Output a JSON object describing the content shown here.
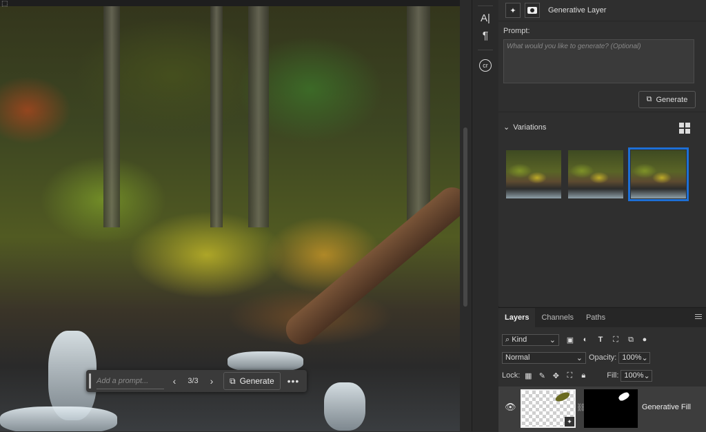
{
  "canvas": {
    "contextual_taskbar": {
      "prompt_placeholder": "Add a prompt...",
      "variation_counter": "3/3",
      "generate_label": "Generate",
      "more_label": "•••"
    }
  },
  "tool_strip": {
    "tools": [
      {
        "icon": "character-panel-icon",
        "glyph": "A|"
      },
      {
        "icon": "paragraph-panel-icon",
        "glyph": "¶"
      },
      {
        "icon": "content-credentials-icon",
        "glyph": "cr"
      }
    ]
  },
  "properties_panel": {
    "header_title": "Generative Layer",
    "prompt_label": "Prompt:",
    "prompt_placeholder": "What would you like to generate? (Optional)",
    "generate_label": "Generate",
    "variations_label": "Variations",
    "variations": [
      {
        "selected": false
      },
      {
        "selected": false
      },
      {
        "selected": true
      }
    ],
    "selection_color": "#1d6fd6"
  },
  "layers_panel": {
    "tabs": [
      "Layers",
      "Channels",
      "Paths"
    ],
    "active_tab": "Layers",
    "filter_kind": "Kind",
    "blend_mode": "Normal",
    "opacity_label": "Opacity:",
    "opacity_value": "100%",
    "lock_label": "Lock:",
    "fill_label": "Fill:",
    "fill_value": "100%",
    "layers": [
      {
        "name": "Generative Fill",
        "visible": true
      }
    ]
  }
}
